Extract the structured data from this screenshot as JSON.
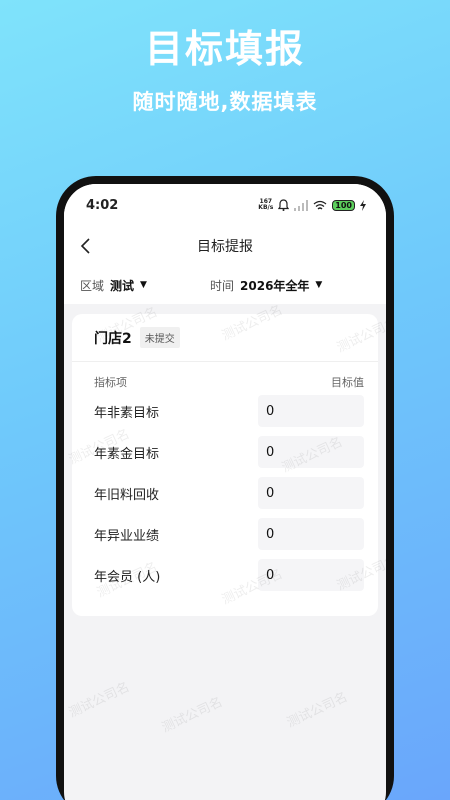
{
  "promo": {
    "title": "目标填报",
    "subtitle": "随时随地,数据填表"
  },
  "statusbar": {
    "time": "4:02",
    "net_speed_value": "167",
    "net_speed_unit": "KB/s",
    "battery": "100",
    "icons": [
      "bell-icon",
      "signal-icon",
      "wifi-icon",
      "battery-icon",
      "charging-icon"
    ]
  },
  "navbar": {
    "title": "目标提报",
    "back_icon": "chevron-left-icon"
  },
  "filters": {
    "region_label": "区域",
    "region_value": "测试",
    "period_label": "时间",
    "period_value": "2026年全年"
  },
  "card": {
    "store_name": "门店2",
    "status_badge": "未提交",
    "column_item": "指标项",
    "column_value": "目标值",
    "rows": [
      {
        "label": "年非素目标",
        "value": "0"
      },
      {
        "label": "年素金目标",
        "value": "0"
      },
      {
        "label": "年旧料回收",
        "value": "0"
      },
      {
        "label": "年异业业绩",
        "value": "0"
      },
      {
        "label": "年会员 (人)",
        "value": "0"
      }
    ]
  },
  "watermark_text": "测试公司名",
  "colors": {
    "gradient_top": "#7fe3fb",
    "gradient_bottom": "#6aa6fb",
    "screen_bg": "#f3f3f5",
    "input_bg": "#f5f5f7",
    "battery_fill": "#5ccf5c"
  }
}
